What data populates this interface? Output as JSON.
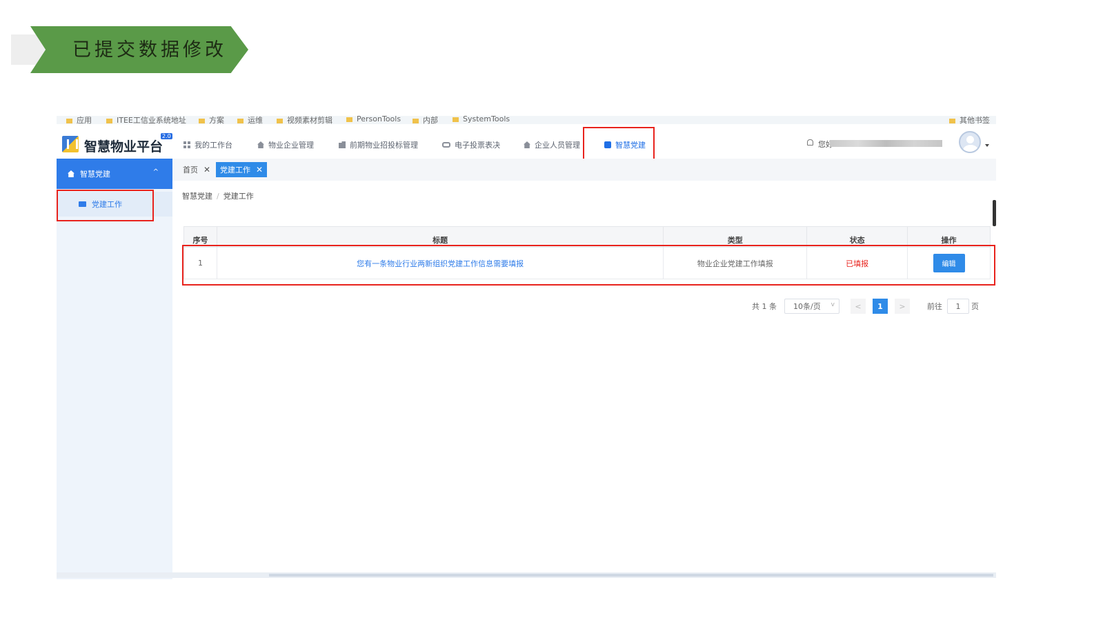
{
  "slide": {
    "title": "已提交数据修改"
  },
  "bookmarks": [
    "应用",
    "ITEE工信业系统地址",
    "方案",
    "运维",
    "视频素材剪辑",
    "PersonTools",
    "内部",
    "SystemTools",
    "其他书签"
  ],
  "header": {
    "logo_text": "智慧物业平台",
    "logo_badge": "2.0",
    "nav": [
      {
        "label": "我的工作台",
        "icon": "grid-icon"
      },
      {
        "label": "物业企业管理",
        "icon": "house-icon"
      },
      {
        "label": "前期物业招投标管理",
        "icon": "building-icon"
      },
      {
        "label": "电子投票表决",
        "icon": "vote-icon"
      },
      {
        "label": "企业人员管理",
        "icon": "house-icon"
      },
      {
        "label": "智慧党建",
        "icon": "edit-icon",
        "active": true
      }
    ],
    "user_greeting": "您好"
  },
  "sidebar": {
    "group_label": "智慧党建",
    "items": [
      {
        "label": "党建工作",
        "active": true
      }
    ]
  },
  "tabs": [
    {
      "label": "首页",
      "active": false
    },
    {
      "label": "党建工作",
      "active": true
    }
  ],
  "breadcrumb": [
    "智慧党建",
    "党建工作"
  ],
  "table": {
    "headers": [
      "序号",
      "标题",
      "类型",
      "状态",
      "操作"
    ],
    "rows": [
      {
        "index": "1",
        "title": "您有一条物业行业两新组织党建工作信息需要填报",
        "type": "物业企业党建工作填报",
        "status": "已填报",
        "action": "编辑"
      }
    ]
  },
  "pagination": {
    "total_text": "共 1 条",
    "page_size": "10条/页",
    "current_page": "1",
    "goto_prefix": "前往",
    "goto_value": "1",
    "goto_suffix": "页"
  },
  "colors": {
    "accent": "#2f7ce9",
    "highlight": "#e8221c",
    "banner": "#5a9a48"
  }
}
